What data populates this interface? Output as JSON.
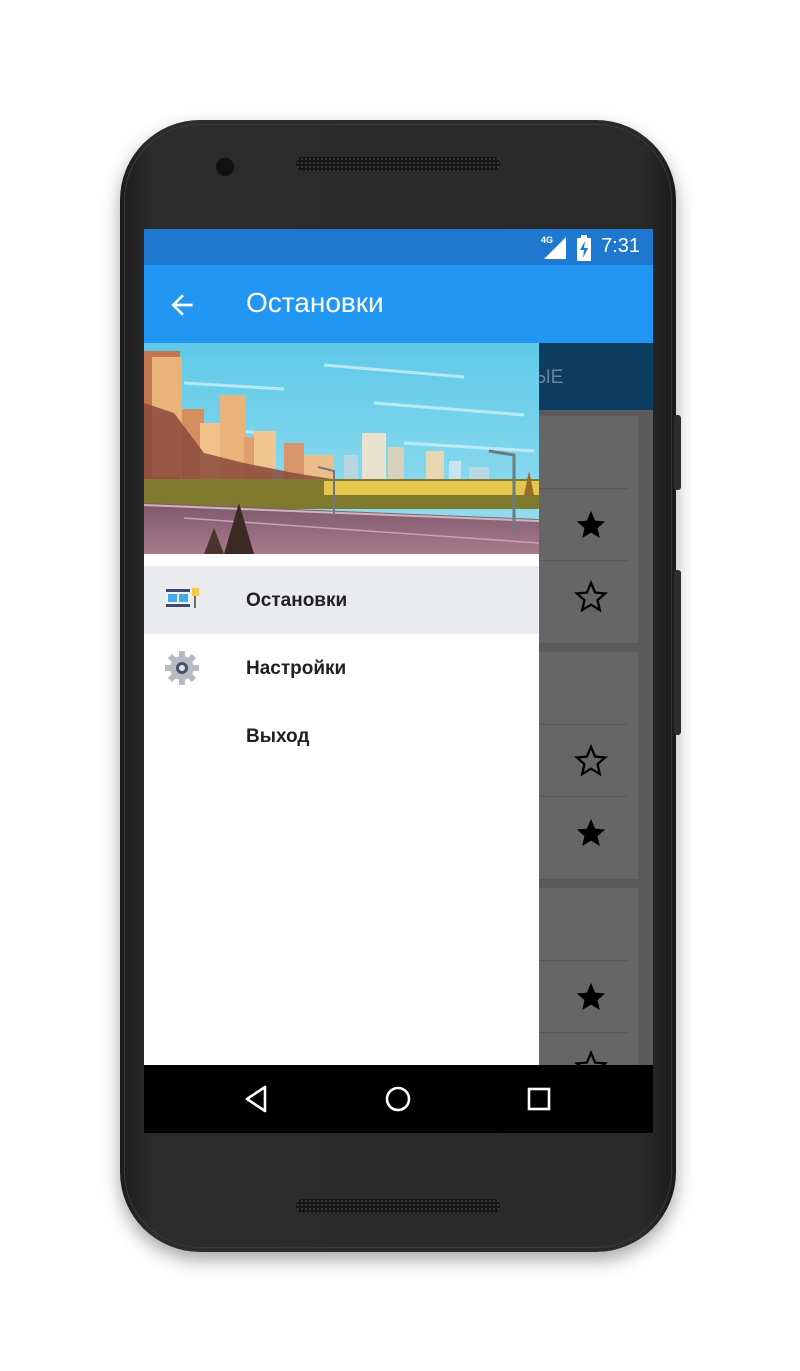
{
  "status_bar": {
    "network": "4G",
    "time": "7:31"
  },
  "app_bar": {
    "back_icon": "arrow-left-icon",
    "title": "Остановки"
  },
  "tab_bar": {
    "visible_tab_fragment": "МЫЕ"
  },
  "drawer": {
    "menu": [
      {
        "label": "Остановки",
        "icon": "bus-stop-icon",
        "selected": true
      },
      {
        "label": "Настройки",
        "icon": "gear-icon",
        "selected": false
      },
      {
        "label": "Выход",
        "icon": "",
        "selected": false
      }
    ]
  },
  "background_list": {
    "stars": [
      "filled",
      "outline",
      "outline",
      "filled",
      "filled",
      "outline"
    ]
  },
  "nav_bar": {
    "buttons": [
      "back-triangle-icon",
      "home-circle-icon",
      "recents-square-icon"
    ]
  },
  "colors": {
    "status_bar": "#1e78cf",
    "app_bar": "#2196f3",
    "tab_bar": "#0d3c61",
    "selected_item": "#eaebee"
  }
}
